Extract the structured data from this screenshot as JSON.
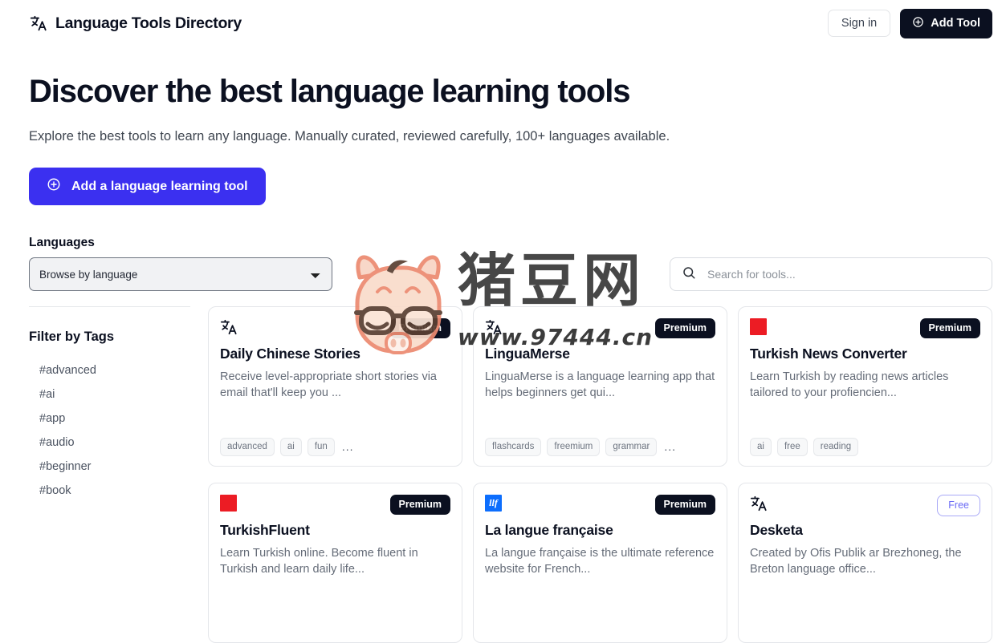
{
  "header": {
    "logo_icon": "translate-icon",
    "title": "Language Tools Directory",
    "sign_in_label": "Sign in",
    "add_tool_label": "Add Tool",
    "add_tool_icon": "plus-circle-icon"
  },
  "hero": {
    "title": "Discover the best language learning tools",
    "subtitle": "Explore the best tools to learn any language. Manually curated, reviewed carefully, 100+ languages available.",
    "cta_label": "Add a language learning tool",
    "cta_icon": "plus-circle-icon",
    "cta_color": "#3b30f0"
  },
  "filters": {
    "languages_label": "Languages",
    "language_select_value": "Browse by language",
    "language_options": [
      "Browse by language"
    ],
    "search_placeholder": "Search for tools...",
    "search_value": "",
    "search_icon": "search-icon"
  },
  "sidebar": {
    "title": "Filter by Tags",
    "tags": [
      "#advanced",
      "#ai",
      "#app",
      "#audio",
      "#beginner",
      "#book"
    ]
  },
  "cards": [
    {
      "icon": "translate-icon",
      "icon_type": "translate",
      "badge": "Premium",
      "badge_type": "premium",
      "title": "Daily Chinese Stories",
      "description": "Receive level-appropriate short stories via email that'll keep you ...",
      "tags": [
        "advanced",
        "ai",
        "fun"
      ],
      "more": "..."
    },
    {
      "icon": "translate-icon",
      "icon_type": "translate",
      "badge": "Premium",
      "badge_type": "premium",
      "title": "LinguaMerse",
      "description": "LinguaMerse is a language learning app that helps beginners get qui...",
      "tags": [
        "flashcards",
        "freemium",
        "grammar"
      ],
      "more": "..."
    },
    {
      "icon": "red-square-favicon-icon",
      "icon_type": "red-square",
      "badge": "Premium",
      "badge_type": "premium",
      "title": "Turkish News Converter",
      "description": "Learn Turkish by reading news articles tailored to your profiencien...",
      "tags": [
        "ai",
        "free",
        "reading"
      ],
      "more": ""
    },
    {
      "icon": "red-square-favicon-icon",
      "icon_type": "red-square",
      "badge": "Premium",
      "badge_type": "premium",
      "title": "TurkishFluent",
      "description": "Learn Turkish online. Become fluent in Turkish and learn daily life...",
      "tags": [],
      "more": ""
    },
    {
      "icon": "blue-square-favicon-icon",
      "icon_type": "blue-square",
      "icon_text": "llf",
      "badge": "Premium",
      "badge_type": "premium",
      "title": "La langue française",
      "description": "La langue française is the ultimate reference website for French...",
      "tags": [],
      "more": ""
    },
    {
      "icon": "translate-icon",
      "icon_type": "translate",
      "badge": "Free",
      "badge_type": "free",
      "title": "Desketa",
      "description": "Created by Ofis Publik ar Brezhoneg, the Breton language office...",
      "tags": [],
      "more": ""
    }
  ],
  "watermark": {
    "brand_text": "猪豆网",
    "url_text": "www.97444.cn",
    "mascot": "pig-face-with-glasses-icon"
  }
}
